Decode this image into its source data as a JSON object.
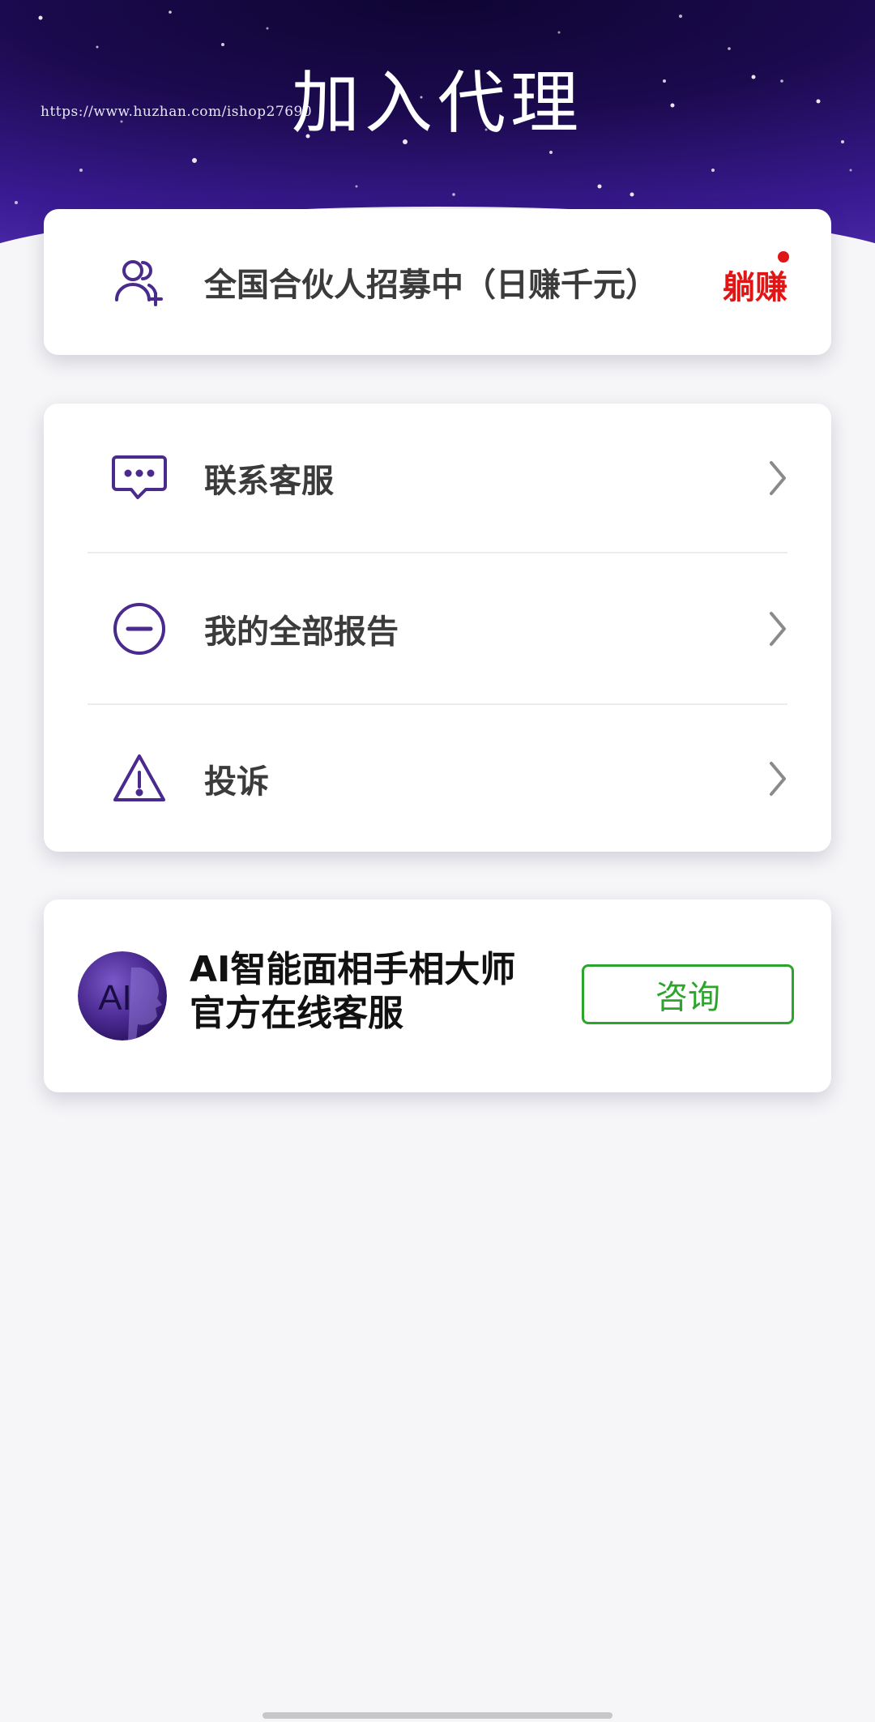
{
  "header": {
    "title": "加入代理",
    "watermark": "https://www.huzhan.com/ishop27690"
  },
  "partner_card": {
    "icon": "add-user-icon",
    "label": "全国合伙人招募中（日赚千元）",
    "badge": "躺赚"
  },
  "menu": {
    "items": [
      {
        "icon": "chat-bubble-icon",
        "label": "联系客服"
      },
      {
        "icon": "minus-circle-icon",
        "label": "我的全部报告"
      },
      {
        "icon": "warning-icon",
        "label": "投诉"
      }
    ]
  },
  "service_card": {
    "avatar_text": "AI",
    "title_line1": "AI智能面相手相大师",
    "title_line2": "官方在线客服",
    "button_label": "咨询"
  },
  "colors": {
    "accent_purple": "#4a2a8c",
    "badge_red": "#e01515",
    "button_green": "#2ca52c",
    "text_dark": "#3b3b3b"
  }
}
